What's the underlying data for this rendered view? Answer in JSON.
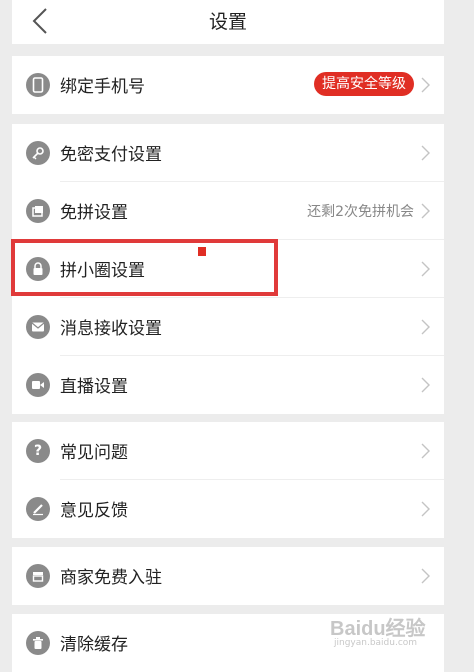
{
  "header": {
    "title": "设置"
  },
  "sections": [
    {
      "items": [
        {
          "name": "bind-phone",
          "icon": "phone-icon",
          "label": "绑定手机号",
          "badge": "提高安全等级"
        }
      ]
    },
    {
      "items": [
        {
          "name": "password-free-pay",
          "icon": "key-icon",
          "label": "免密支付设置"
        },
        {
          "name": "free-group",
          "icon": "coupon-icon",
          "label": "免拼设置",
          "value": "还剩2次免拼机会"
        },
        {
          "name": "circle",
          "icon": "lock-icon",
          "label": "拼小圈设置"
        },
        {
          "name": "message",
          "icon": "envelope-icon",
          "label": "消息接收设置"
        },
        {
          "name": "live",
          "icon": "video-camera-icon",
          "label": "直播设置"
        }
      ]
    },
    {
      "items": [
        {
          "name": "faq",
          "icon": "question-icon",
          "label": "常见问题"
        },
        {
          "name": "feedback",
          "icon": "pencil-icon",
          "label": "意见反馈"
        }
      ]
    },
    {
      "items": [
        {
          "name": "merchant",
          "icon": "store-icon",
          "label": "商家免费入驻"
        }
      ]
    },
    {
      "items": [
        {
          "name": "clear-cache",
          "icon": "trash-icon",
          "label": "清除缓存"
        }
      ]
    }
  ],
  "watermark": {
    "brand": "Baidu经验",
    "url": "jingyan.baidu.com"
  },
  "colors": {
    "accent": "#e02e24",
    "highlight": "#e03a3a",
    "icon": "#8a8a8a"
  }
}
